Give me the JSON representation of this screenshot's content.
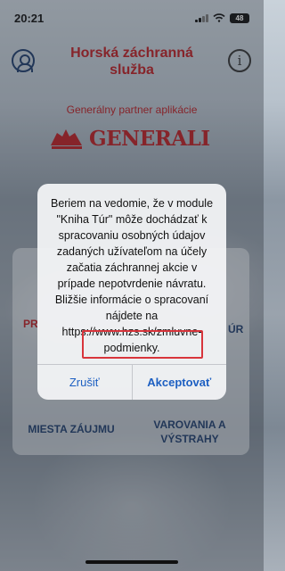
{
  "status_bar": {
    "time": "20:21",
    "battery": "48"
  },
  "header": {
    "title": "Horská záchranná služba",
    "info_label": "i"
  },
  "partner": {
    "label": "Generálny partner aplikácie",
    "brand": "GENERALI"
  },
  "menu": {
    "tile_partial_left": "PR",
    "tile_partial_right": "ÚR",
    "tile_miesta": "MIESTA ZÁUJMU",
    "tile_varovania": "VAROVANIA A VÝSTRAHY"
  },
  "dialog": {
    "message": "Beriem na vedomie, že v module \"Kniha Túr\" môže dochádzať k spracovaniu osobných údajov zadaných užívateľom na účely začatia záchrannej akcie v prípade nepotvrdenie návratu. Bližšie informácie o spracovaní nájdete na https://www.hzs.sk/zmluvne-podmienky.",
    "cancel_label": "Zrušiť",
    "accept_label": "Akceptovať"
  },
  "colors": {
    "brand_red": "#b81f24",
    "navy": "#1f3d6b",
    "ios_blue": "#1d5fc2"
  }
}
